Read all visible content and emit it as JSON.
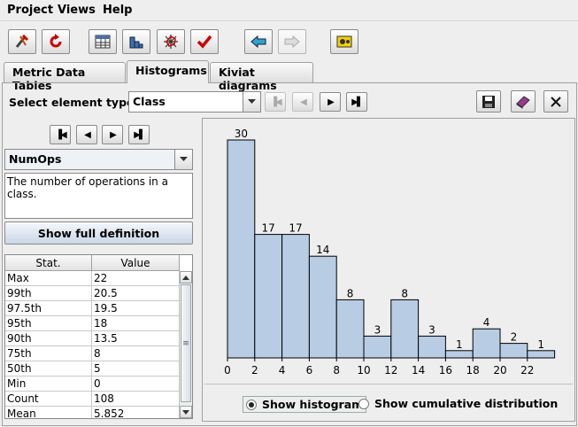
{
  "menu": {
    "project": "Project",
    "views": "Views",
    "help": "Help"
  },
  "toolbar": {
    "icons": [
      "tools-icon",
      "refresh-icon",
      "table-icon",
      "bar-chart-icon",
      "kiviat-icon",
      "check-icon",
      "back-arrow-icon",
      "forward-arrow-icon",
      "settings-icon"
    ]
  },
  "tabs": [
    {
      "label": "Metric Data Tables",
      "active": false
    },
    {
      "label": "Histograms",
      "active": true
    },
    {
      "label": "Kiviat diagrams",
      "active": false
    }
  ],
  "element_type": {
    "label": "Select element type",
    "value": "Class"
  },
  "metric": {
    "value": "NumOps",
    "description": "The number of operations in a class.",
    "definition_button": "Show full definition"
  },
  "stats": {
    "headers": [
      "Stat.",
      "Value"
    ],
    "rows": [
      [
        "Max",
        "22"
      ],
      [
        "99th",
        "20.5"
      ],
      [
        "97.5th",
        "19.5"
      ],
      [
        "95th",
        "18"
      ],
      [
        "90th",
        "13.5"
      ],
      [
        "75th",
        "8"
      ],
      [
        "50th",
        "5"
      ],
      [
        "Min",
        "0"
      ],
      [
        "Count",
        "108"
      ],
      [
        "Mean",
        "5.852"
      ]
    ]
  },
  "view_options": {
    "histogram": "Show histogram",
    "cumulative": "Show cumulative distribution",
    "selected": "histogram"
  },
  "colors": {
    "bar_fill": "#b8cce4",
    "bar_stroke": "#000000"
  },
  "chart_data": {
    "type": "bar",
    "bin_width": 2,
    "bins": [
      0,
      2,
      4,
      6,
      8,
      10,
      12,
      14,
      16,
      18,
      20,
      22
    ],
    "values": [
      30,
      17,
      17,
      14,
      8,
      3,
      8,
      3,
      1,
      4,
      2,
      1
    ],
    "xticks": [
      "0",
      "2",
      "4",
      "6",
      "8",
      "10",
      "12",
      "14",
      "16",
      "18",
      "20",
      "22"
    ],
    "title": "",
    "xlabel": "",
    "ylabel": ""
  }
}
